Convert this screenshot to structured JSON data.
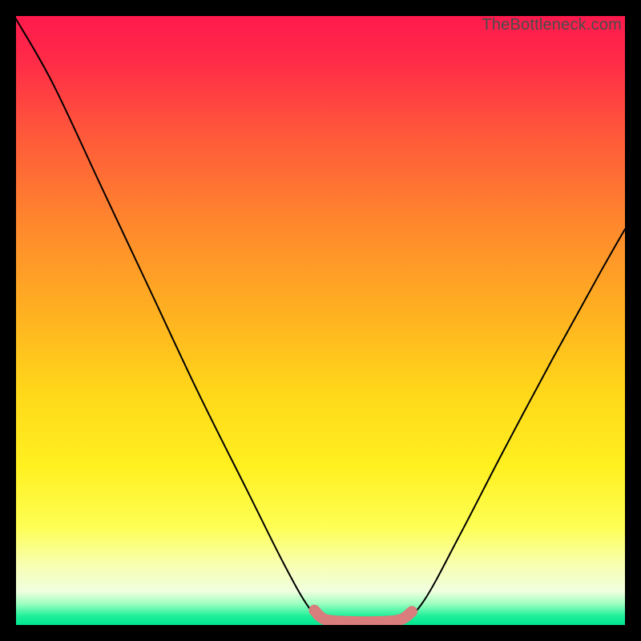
{
  "attribution": "TheBottleneck.com",
  "chart_data": {
    "type": "line",
    "title": "",
    "xlabel": "",
    "ylabel": "",
    "xlim": [
      0,
      100
    ],
    "ylim": [
      0,
      100
    ],
    "background_gradient_stops": [
      {
        "offset": 0.0,
        "color": "#ff1a4d"
      },
      {
        "offset": 0.07,
        "color": "#ff2a48"
      },
      {
        "offset": 0.2,
        "color": "#ff5a3a"
      },
      {
        "offset": 0.35,
        "color": "#ff8a2c"
      },
      {
        "offset": 0.5,
        "color": "#ffb420"
      },
      {
        "offset": 0.62,
        "color": "#ffd81a"
      },
      {
        "offset": 0.74,
        "color": "#fff020"
      },
      {
        "offset": 0.84,
        "color": "#feff55"
      },
      {
        "offset": 0.9,
        "color": "#f8ffb0"
      },
      {
        "offset": 0.945,
        "color": "#f0ffe0"
      },
      {
        "offset": 0.965,
        "color": "#9effc0"
      },
      {
        "offset": 0.985,
        "color": "#20f09a"
      },
      {
        "offset": 1.0,
        "color": "#00e690"
      }
    ],
    "series": [
      {
        "name": "bottleneck-curve",
        "color": "#000000",
        "stroke_width": 2,
        "points": [
          {
            "x": 0.0,
            "y": 99.5
          },
          {
            "x": 6.0,
            "y": 89.0
          },
          {
            "x": 14.0,
            "y": 72.0
          },
          {
            "x": 22.0,
            "y": 55.0
          },
          {
            "x": 30.0,
            "y": 38.0
          },
          {
            "x": 38.0,
            "y": 22.0
          },
          {
            "x": 44.0,
            "y": 10.0
          },
          {
            "x": 48.0,
            "y": 3.0
          },
          {
            "x": 50.5,
            "y": 0.8
          },
          {
            "x": 55.0,
            "y": 0.4
          },
          {
            "x": 60.0,
            "y": 0.4
          },
          {
            "x": 63.5,
            "y": 0.8
          },
          {
            "x": 67.0,
            "y": 4.0
          },
          {
            "x": 73.0,
            "y": 15.0
          },
          {
            "x": 80.0,
            "y": 28.5
          },
          {
            "x": 88.0,
            "y": 43.5
          },
          {
            "x": 96.0,
            "y": 58.0
          },
          {
            "x": 100.0,
            "y": 65.0
          }
        ]
      },
      {
        "name": "highlight-band",
        "color": "#d97c7c",
        "stroke_width": 14,
        "linecap": "round",
        "points": [
          {
            "x": 49.0,
            "y": 2.4
          },
          {
            "x": 50.8,
            "y": 0.9
          },
          {
            "x": 55.0,
            "y": 0.55
          },
          {
            "x": 60.0,
            "y": 0.55
          },
          {
            "x": 63.2,
            "y": 0.9
          },
          {
            "x": 65.0,
            "y": 2.2
          }
        ]
      }
    ]
  }
}
